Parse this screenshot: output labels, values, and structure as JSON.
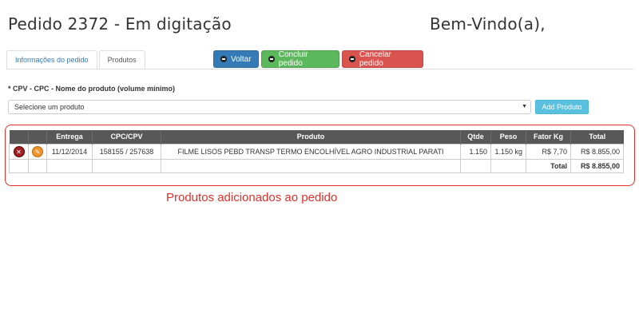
{
  "header": {
    "title": "Pedido 2372 - Em digitação",
    "welcome": "Bem-Vindo(a),"
  },
  "tabs": [
    {
      "label": "Informações do pedido",
      "active": false
    },
    {
      "label": "Produtos",
      "active": true
    }
  ],
  "actions": {
    "voltar": {
      "label": "Voltar",
      "color": "#337ab7"
    },
    "concluir": {
      "label": "Concluir pedido",
      "color": "#5cb85c"
    },
    "cancelar": {
      "label": "Cancelar pedido",
      "color": "#d9534f"
    }
  },
  "product_form": {
    "label": "* CPV - CPC - Nome do produto (volume mínimo)",
    "select_value": "Selecione um produto",
    "add_label": "Add Produto"
  },
  "table": {
    "headers": {
      "entrega": "Entrega",
      "cpc": "CPC/CPV",
      "produto": "Produto",
      "qtde": "Qtde",
      "peso": "Peso",
      "fator": "Fator Kg",
      "total": "Total"
    },
    "rows": [
      {
        "entrega": "11/12/2014",
        "cpc": "158155 / 257638",
        "produto": "FILME LISOS PEBD TRANSP TERMO ENCOLHÍVEL AGRO INDUSTRIAL PARATI",
        "qtde": "1.150",
        "peso": "1.150 kg",
        "fator": "R$ 7,70",
        "total": "R$ 8.855,00"
      }
    ],
    "summary": {
      "label": "Total",
      "value": "R$ 8.855,00"
    }
  },
  "annotation": {
    "text": "Produtos adicionados ao pedido",
    "color": "#e0312a"
  }
}
